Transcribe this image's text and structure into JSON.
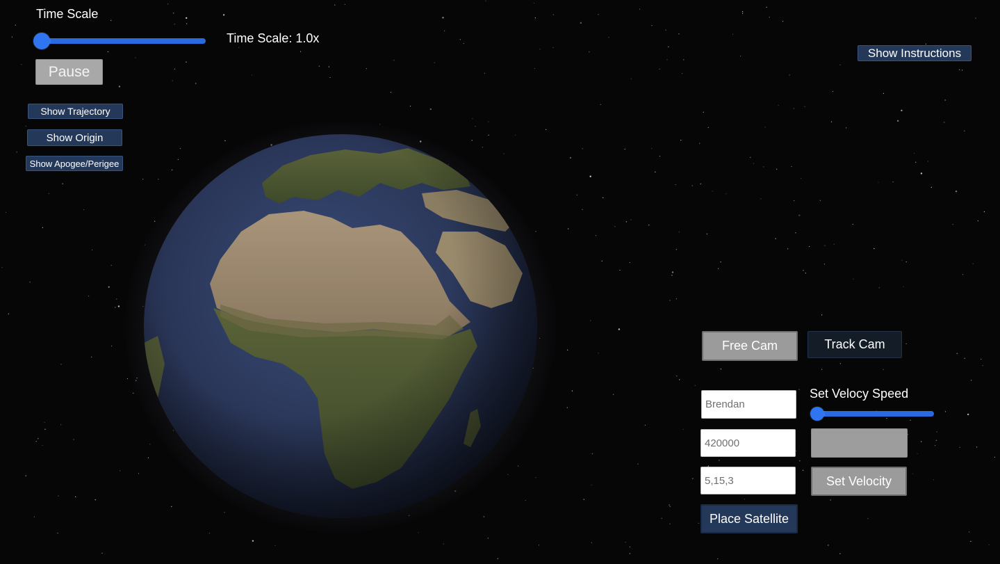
{
  "time_controls": {
    "heading": "Time Scale",
    "readout": "Time Scale: 1.0x",
    "slider_value": 0.0,
    "pause_label": "Pause"
  },
  "toggles": {
    "trajectory_label": "Show Trajectory",
    "origin_label": "Show Origin",
    "apsides_label": "Show Apogee/Perigee"
  },
  "help": {
    "instructions_label": "Show Instructions"
  },
  "camera": {
    "free_label": "Free Cam",
    "track_label": "Track Cam"
  },
  "satellite_form": {
    "name_value": "Brendan",
    "altitude_value": "420000",
    "vector_value": "5,15,3",
    "place_label": "Place Satellite",
    "velocity_speed_heading": "Set Velocy Speed",
    "velocity_speed_value": 0.0,
    "set_velocity_label": "Set Velocity"
  },
  "colors": {
    "accent_blue": "#2f74f0",
    "navy_button": "#24385a",
    "grey_button": "#a8a8a8",
    "space_background": "#060607"
  }
}
